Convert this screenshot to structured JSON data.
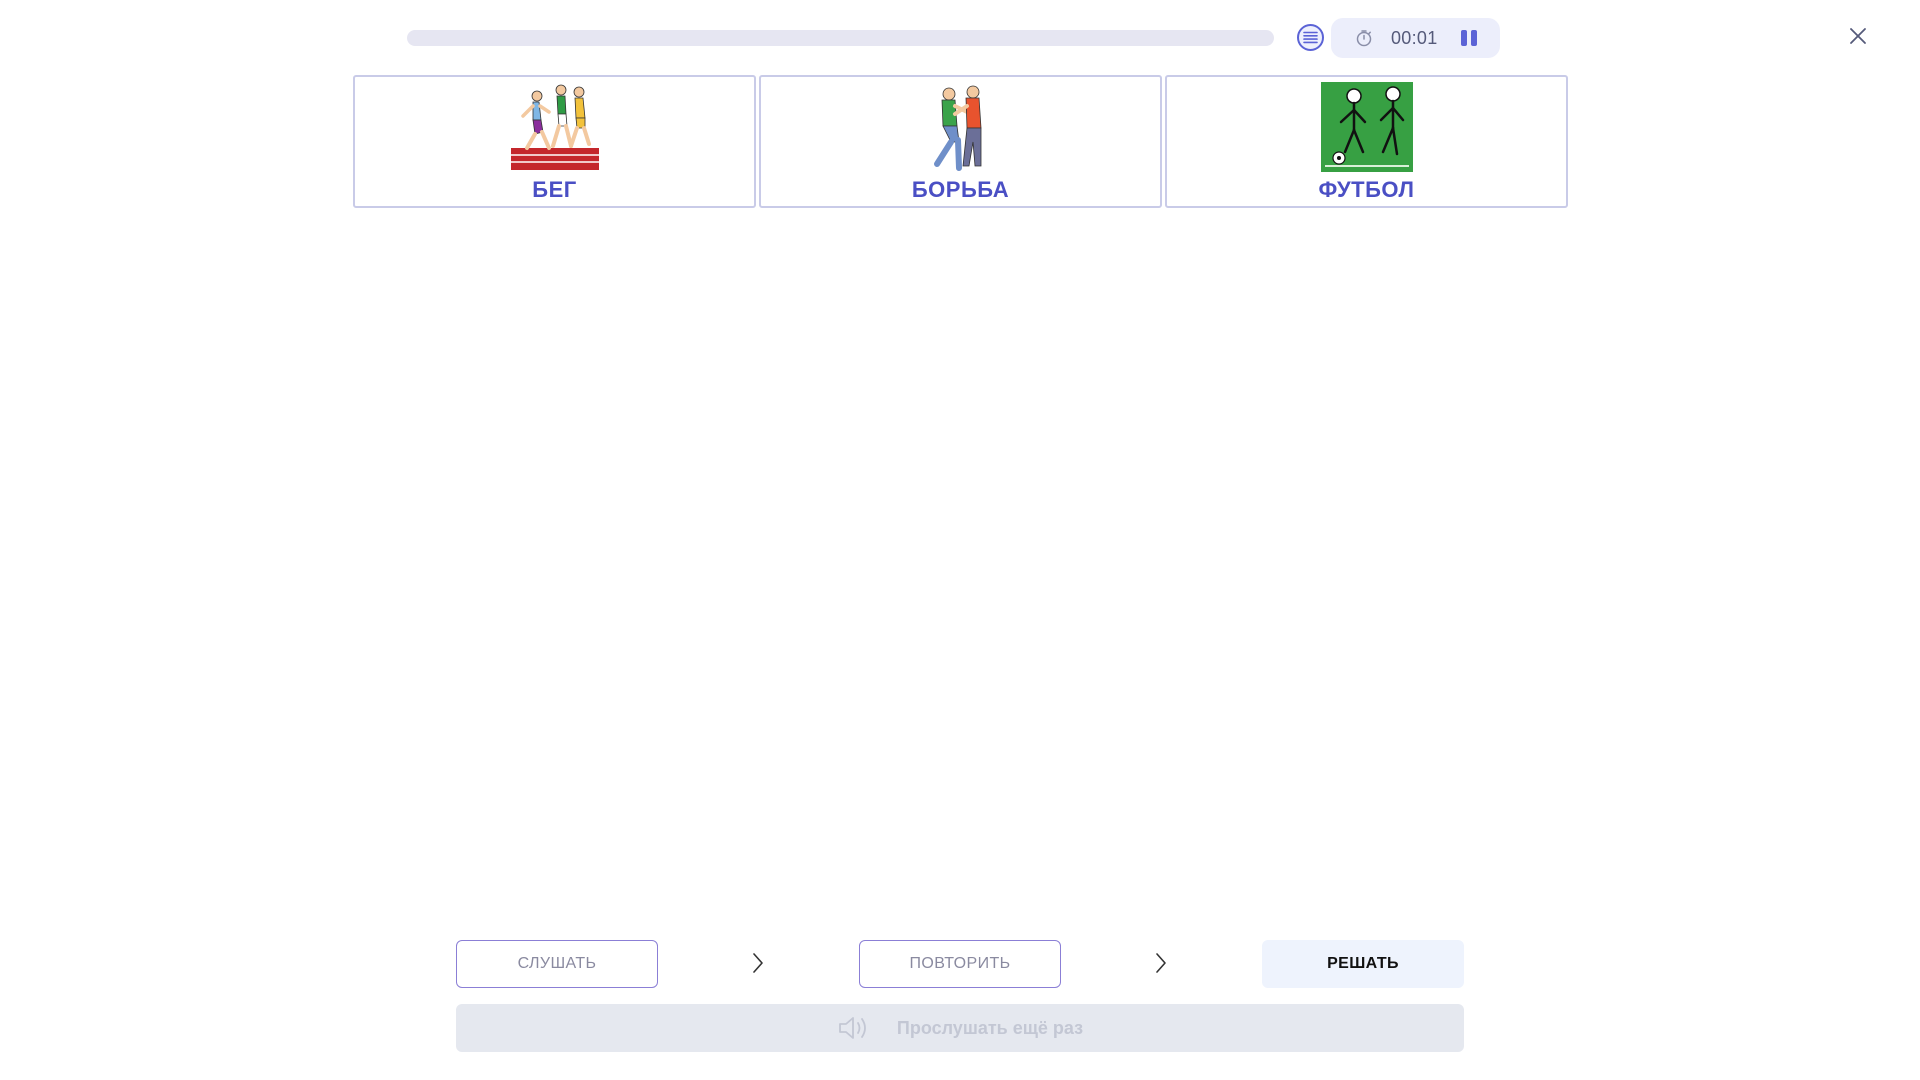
{
  "header": {
    "progress": 0,
    "timer": "00:01",
    "icons": {
      "list": "list-icon",
      "timer": "stopwatch-icon",
      "pause": "pause-icon",
      "close": "close-icon"
    }
  },
  "cards": [
    {
      "label": "БЕГ",
      "icon": "running-people-picture"
    },
    {
      "label": "БОРЬБА",
      "icon": "wrestling-people-picture"
    },
    {
      "label": "ФУТБОЛ",
      "icon": "football-players-picture"
    }
  ],
  "steps": [
    {
      "label": "СЛУШАТЬ",
      "state": "done"
    },
    {
      "label": "ПОВТОРИТЬ",
      "state": "done"
    },
    {
      "label": "РЕШАТЬ",
      "state": "active"
    }
  ],
  "replay": {
    "label": "Прослушать ещё раз",
    "icon": "speaker-icon"
  },
  "colors": {
    "accent": "#5b63d6",
    "card_label": "#4a4fc4",
    "card_border": "#c9cbe8",
    "timer_bg": "#eceefb",
    "active_step_bg": "#eef3fd",
    "replay_bg": "#e5e8ef"
  }
}
